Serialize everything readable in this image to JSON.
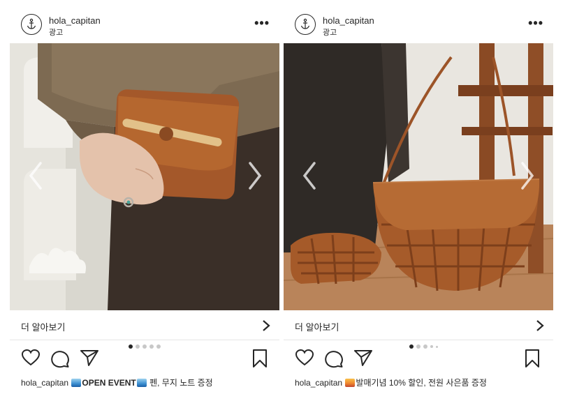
{
  "posts": [
    {
      "username": "hola_capitan",
      "sponsored_label": "광고",
      "more_label": "•••",
      "cta_label": "더 알아보기",
      "carousel": {
        "total": 5,
        "active": 1
      },
      "caption_user": "hola_capitan",
      "caption_emoji": "wave-emoji",
      "caption_text": "OPEN EVENT",
      "caption_rest": " 펜, 무지 노트 증정"
    },
    {
      "username": "hola_capitan",
      "sponsored_label": "광고",
      "more_label": "•••",
      "cta_label": "더 알아보기",
      "carousel": {
        "total": 5,
        "active": 1
      },
      "caption_user": "hola_capitan",
      "caption_emoji": "sunrise-emoji",
      "caption_text": "발매기념 10% 할인, 전원 사은품 증정"
    }
  ],
  "colors": {
    "text": "#262626",
    "divider": "#e6e6e6",
    "dot_inactive": "#c8c8c8",
    "leather": "#a4582a"
  },
  "icons": [
    "anchor-icon",
    "heart-icon",
    "comment-icon",
    "share-icon",
    "bookmark-icon",
    "chevron-left-icon",
    "chevron-right-icon"
  ]
}
